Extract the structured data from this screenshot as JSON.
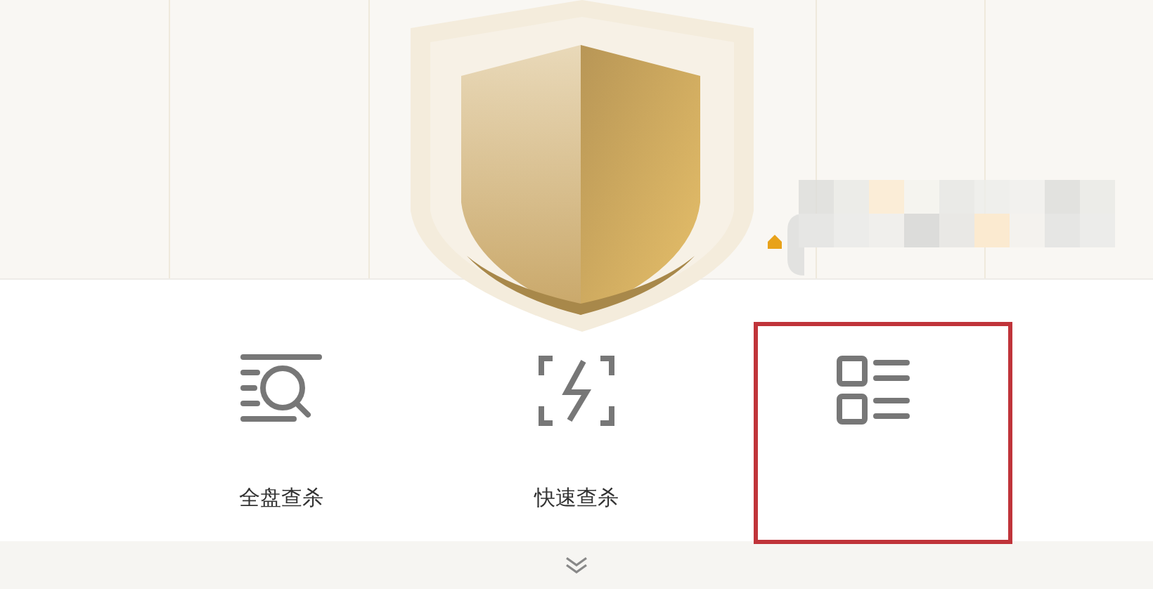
{
  "scan_modes": [
    {
      "kind": "full",
      "label": "全盘查杀"
    },
    {
      "kind": "quick",
      "label": "快速查杀"
    },
    {
      "kind": "custom"
    }
  ],
  "highlight": {
    "on": true
  }
}
